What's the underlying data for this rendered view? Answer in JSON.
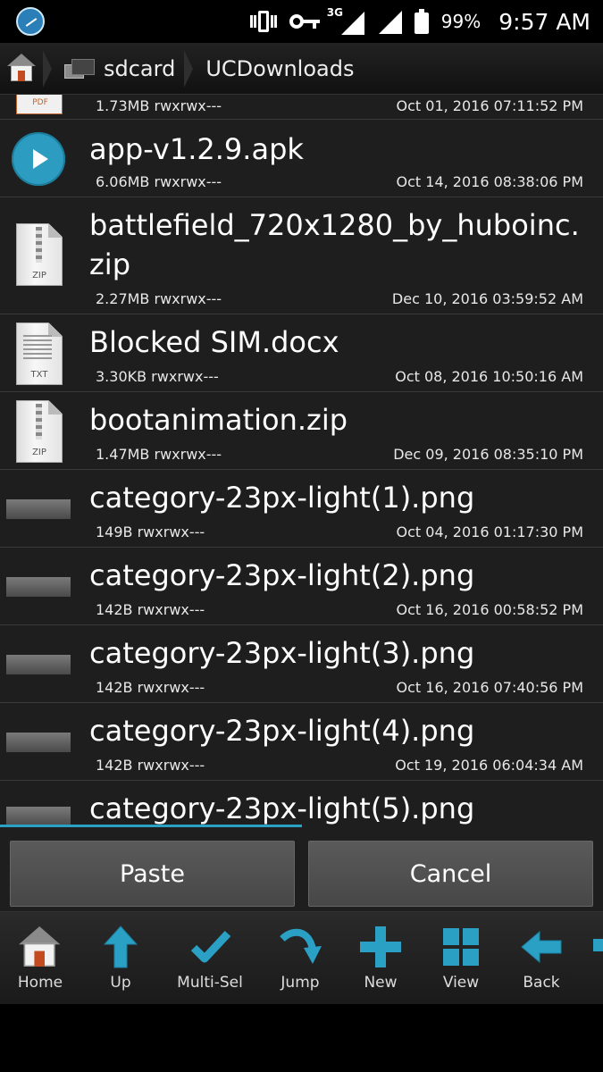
{
  "status_bar": {
    "network_label": "3G",
    "battery_percent": "99%",
    "time": "9:57 AM"
  },
  "path_bar": {
    "segments": [
      "sdcard",
      "UCDownloads"
    ]
  },
  "files": [
    {
      "name": "",
      "meta": "1.73MB rwxrwx---",
      "date": "Oct 01, 2016 07:11:52 PM",
      "icon": "pdf-icon",
      "icon_label": "PDF"
    },
    {
      "name": "app-v1.2.9.apk",
      "meta": "6.06MB rwxrwx---",
      "date": "Oct 14, 2016 08:38:06 PM",
      "icon": "apk-icon"
    },
    {
      "name_line1": "battlefield_720x1280_by_huboinc.",
      "name_line2": "zip",
      "meta": "2.27MB rwxrwx---",
      "date": "Dec 10, 2016 03:59:52 AM",
      "icon": "zip-icon",
      "icon_label": "ZIP"
    },
    {
      "name": "Blocked SIM.docx",
      "meta": "3.30KB rwxrwx---",
      "date": "Oct 08, 2016 10:50:16 AM",
      "icon": "txt-icon",
      "icon_label": "TXT"
    },
    {
      "name": "bootanimation.zip",
      "meta": "1.47MB rwxrwx---",
      "date": "Dec 09, 2016 08:35:10 PM",
      "icon": "zip-icon",
      "icon_label": "ZIP"
    },
    {
      "name": "category-23px-light(1).png",
      "meta": "149B rwxrwx---",
      "date": "Oct 04, 2016 01:17:30 PM",
      "icon": "image-icon"
    },
    {
      "name": "category-23px-light(2).png",
      "meta": "142B rwxrwx---",
      "date": "Oct 16, 2016 00:58:52 PM",
      "icon": "image-icon"
    },
    {
      "name": "category-23px-light(3).png",
      "meta": "142B rwxrwx---",
      "date": "Oct 16, 2016 07:40:56 PM",
      "icon": "image-icon"
    },
    {
      "name": "category-23px-light(4).png",
      "meta": "142B rwxrwx---",
      "date": "Oct 19, 2016 06:04:34 AM",
      "icon": "image-icon"
    },
    {
      "name": "category-23px-light(5).png",
      "icon": "image-icon"
    }
  ],
  "actions": {
    "paste_label": "Paste",
    "cancel_label": "Cancel"
  },
  "toolbar": {
    "items": [
      "Home",
      "Up",
      "Multi-Sel",
      "Jump",
      "New",
      "View",
      "Back"
    ]
  },
  "colors": {
    "accent": "#2aa0c4",
    "list_background": "#1e1e1e",
    "button_background": "#4f4f4f"
  }
}
